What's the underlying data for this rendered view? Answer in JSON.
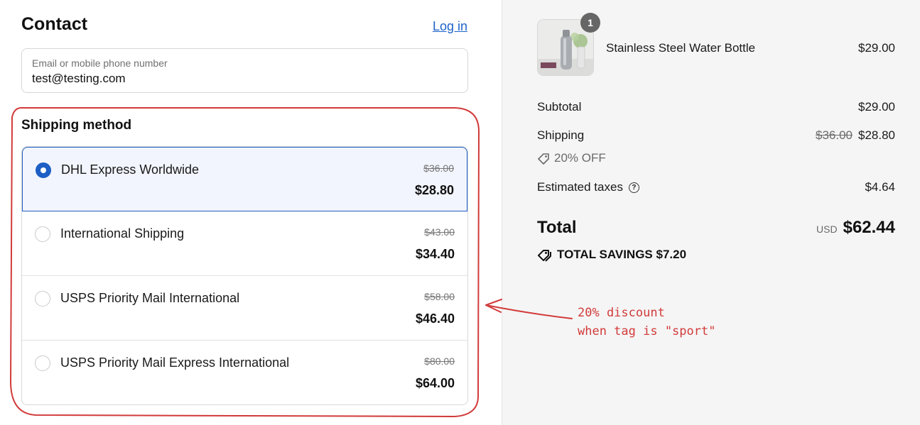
{
  "contact": {
    "title": "Contact",
    "login_label": "Log in",
    "email_placeholder": "Email or mobile phone number",
    "email_value": "test@testing.com"
  },
  "shipping": {
    "title": "Shipping method",
    "options": [
      {
        "name": "DHL Express Worldwide",
        "old_price": "$36.00",
        "price": "$28.80",
        "selected": true
      },
      {
        "name": "International Shipping",
        "old_price": "$43.00",
        "price": "$34.40",
        "selected": false
      },
      {
        "name": "USPS Priority Mail International",
        "old_price": "$58.00",
        "price": "$46.40",
        "selected": false
      },
      {
        "name": "USPS Priority Mail Express International",
        "old_price": "$80.00",
        "price": "$64.00",
        "selected": false
      }
    ]
  },
  "summary": {
    "product": {
      "name": "Stainless Steel Water Bottle",
      "price": "$29.00",
      "quantity": "1"
    },
    "subtotal_label": "Subtotal",
    "subtotal_value": "$29.00",
    "shipping_label": "Shipping",
    "shipping_old": "$36.00",
    "shipping_value": "$28.80",
    "discount_label": "20% OFF",
    "taxes_label": "Estimated taxes",
    "taxes_value": "$4.64",
    "total_label": "Total",
    "total_currency": "USD",
    "total_value": "$62.44",
    "savings_label": "TOTAL SAVINGS",
    "savings_value": "$7.20"
  },
  "annotation": {
    "line1": "20% discount",
    "line2": "when tag is \"sport\"",
    "color": "#d23a3a"
  },
  "colors": {
    "accent": "#1d5fc4",
    "link": "#1f63c9",
    "panel_bg": "#f5f5f5"
  }
}
